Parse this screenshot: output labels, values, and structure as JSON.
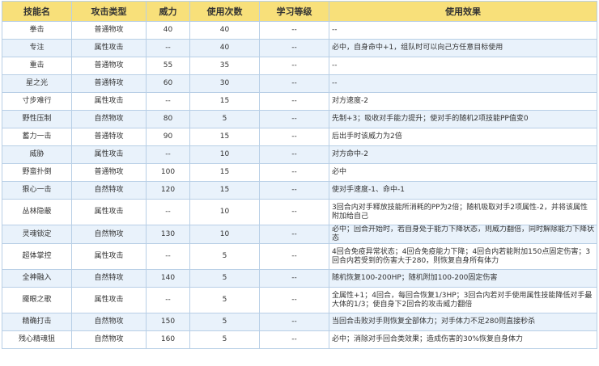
{
  "headers": {
    "name": "技能名",
    "type": "攻击类型",
    "power": "威力",
    "uses": "使用次数",
    "level": "学习等级",
    "effect": "使用效果"
  },
  "rows": [
    {
      "name": "拳击",
      "type": "普通物攻",
      "power": "40",
      "uses": "40",
      "level": "--",
      "effect": "--"
    },
    {
      "name": "专注",
      "type": "属性攻击",
      "power": "--",
      "uses": "40",
      "level": "--",
      "effect": "必中，自身命中+1，组队时可以向己方任意目标使用"
    },
    {
      "name": "重击",
      "type": "普通物攻",
      "power": "55",
      "uses": "35",
      "level": "--",
      "effect": "--"
    },
    {
      "name": "星之光",
      "type": "普通特攻",
      "power": "60",
      "uses": "30",
      "level": "--",
      "effect": "--"
    },
    {
      "name": "寸步难行",
      "type": "属性攻击",
      "power": "--",
      "uses": "15",
      "level": "--",
      "effect": "对方速度-2"
    },
    {
      "name": "野性压制",
      "type": "自然物攻",
      "power": "80",
      "uses": "5",
      "level": "--",
      "effect": "先制+3；吸收对手能力提升；使对手的随机2项技能PP值变0"
    },
    {
      "name": "蓄力一击",
      "type": "普通特攻",
      "power": "90",
      "uses": "15",
      "level": "--",
      "effect": "后出手时该威力为2倍"
    },
    {
      "name": "威胁",
      "type": "属性攻击",
      "power": "--",
      "uses": "10",
      "level": "--",
      "effect": "对方命中-2"
    },
    {
      "name": "野蛮扑倒",
      "type": "普通物攻",
      "power": "100",
      "uses": "15",
      "level": "--",
      "effect": "必中"
    },
    {
      "name": "狠心一击",
      "type": "自然特攻",
      "power": "120",
      "uses": "15",
      "level": "--",
      "effect": "使对手速度-1、命中-1"
    },
    {
      "name": "丛林隐蔽",
      "type": "属性攻击",
      "power": "--",
      "uses": "10",
      "level": "--",
      "effect": "3回合内对手释放技能所消耗的PP为2倍；随机吸取对手2项属性-2，并将该属性附加给自己",
      "tall": true
    },
    {
      "name": "灵魂锁定",
      "type": "自然物攻",
      "power": "130",
      "uses": "10",
      "level": "--",
      "effect": "必中；回合开始时，若自身处于能力下降状态，则威力翻倍，同时解除能力下降状态"
    },
    {
      "name": "超体掌控",
      "type": "属性攻击",
      "power": "--",
      "uses": "5",
      "level": "--",
      "effect": "4回合免疫异常状态；4回合免疫能力下降；4回合内若能附加150点固定伤害；3回合内若受到的伤害大于280，则恢复自身所有体力",
      "tall": true
    },
    {
      "name": "全神融入",
      "type": "自然特攻",
      "power": "140",
      "uses": "5",
      "level": "--",
      "effect": "随机恢复100-200HP；随机附加100-200固定伤害"
    },
    {
      "name": "魇眼之歌",
      "type": "属性攻击",
      "power": "--",
      "uses": "5",
      "level": "--",
      "effect": "全属性+1；4回合，每回合恢复1/3HP；3回合内若对手使用属性技能降低对手最大体的1/3；使自身下2回合的攻击威力翻倍",
      "tall": true
    },
    {
      "name": "精确打击",
      "type": "自然物攻",
      "power": "150",
      "uses": "5",
      "level": "--",
      "effect": "当回合击败对手则恢复全部体力；对手体力不足280则直接秒杀"
    },
    {
      "name": "残心精魂狙",
      "type": "自然物攻",
      "power": "160",
      "uses": "5",
      "level": "--",
      "effect": "必中；消除对手回合类效果；造成伤害的30%恢复自身体力"
    }
  ]
}
